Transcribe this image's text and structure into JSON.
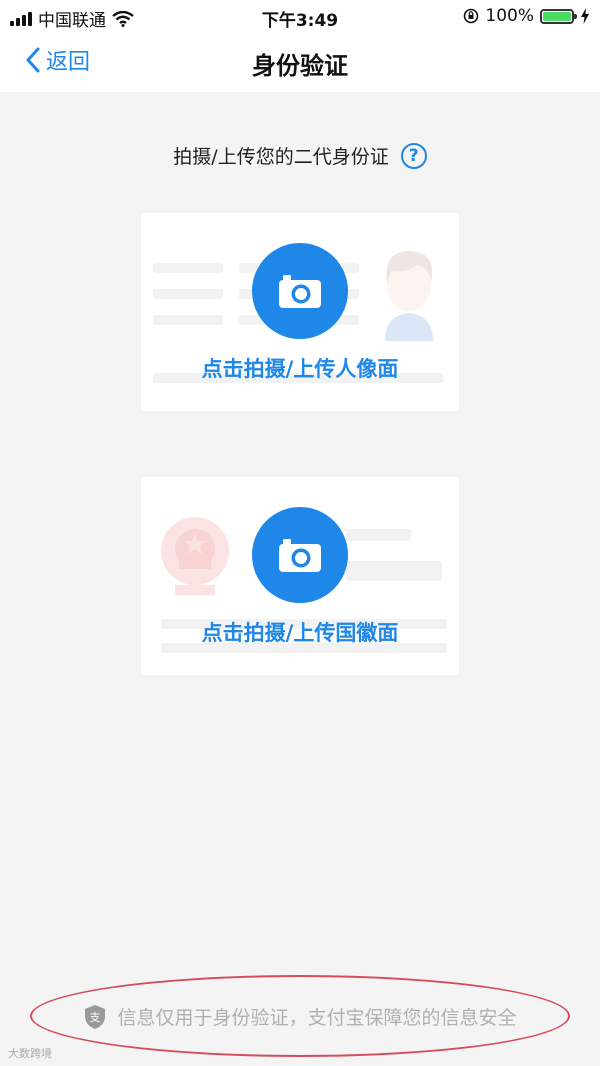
{
  "status_bar": {
    "carrier": "中国联通",
    "time": "下午3:49",
    "battery_percent": "100%",
    "battery_level": 1.0,
    "battery_color": "#4cd964"
  },
  "nav": {
    "back_label": "返回",
    "title": "身份验证"
  },
  "prompt": {
    "text": "拍摄/上传您的二代身份证",
    "help_glyph": "?"
  },
  "cards": [
    {
      "label": "点击拍摄/上传人像面",
      "icon": "camera-icon",
      "illustration": "portrait-avatar"
    },
    {
      "label": "点击拍摄/上传国徽面",
      "icon": "camera-icon",
      "illustration": "national-emblem"
    }
  ],
  "footer": {
    "text": "信息仅用于身份验证，支付宝保障您的信息安全",
    "icon": "alipay-shield-icon",
    "shield_glyph": "支"
  },
  "watermark": {
    "text": "大数跨境"
  },
  "colors": {
    "accent": "#1f87e8",
    "annotation": "#d84b5d",
    "background": "#f4f4f4"
  }
}
